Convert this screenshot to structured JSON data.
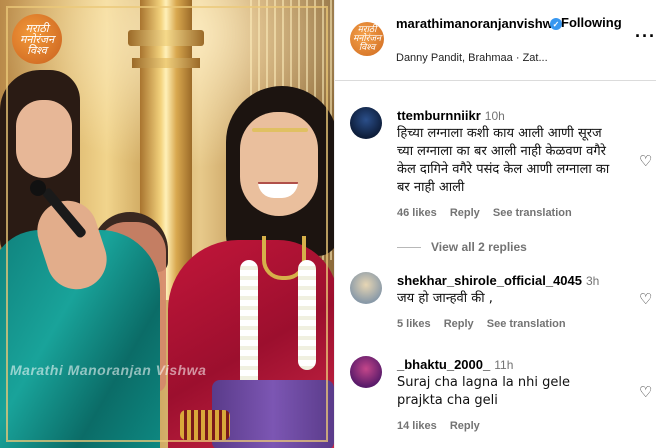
{
  "video": {
    "logo_text": "मराठी मनोरंजन विश्व",
    "watermark": "Marathi Manoranjan Vishwa"
  },
  "header": {
    "username": "marathimanoranjanvishwa",
    "follow_label": "Following",
    "more_label": "···",
    "audio": "Danny Pandit, Brahmaa · Zat..."
  },
  "comments": [
    {
      "username": "ttemburnniikr",
      "time": "10h",
      "text": "हिच्या लग्नाला कशी काय आली आणी सूरज च्या लग्नाला का बर आली नाही केळवण वगैरे केल दागिने वगैरे पसंद केल आणी लग्नाला का बर नाही आली",
      "likes": "46 likes",
      "reply_label": "Reply",
      "translate_label": "See translation"
    },
    {
      "username": "shekhar_shirole_official_4045",
      "time": "3h",
      "text": "जय हो जान्हवी की ,",
      "likes": "5 likes",
      "reply_label": "Reply",
      "translate_label": "See translation"
    },
    {
      "username": "_bhaktu_2000_",
      "time": "11h",
      "text": "Suraj cha lagna la nhi gele prajkta cha geli",
      "likes": "14 likes",
      "reply_label": "Reply"
    }
  ],
  "view_replies_label": "View all 2 replies",
  "icons": {
    "verified": "verified-badge-icon",
    "heart": "heart-icon",
    "more": "more-options-icon"
  },
  "colors": {
    "verified_blue": "#3897f0",
    "muted_text": "#737373"
  }
}
